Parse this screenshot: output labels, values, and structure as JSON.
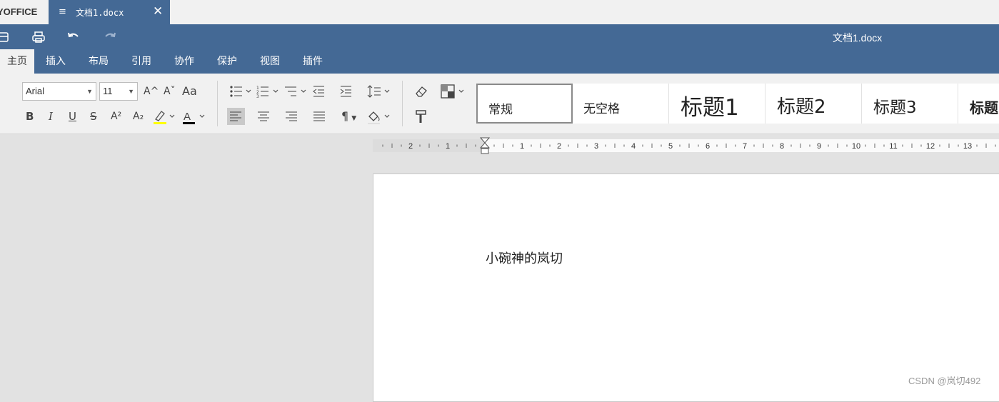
{
  "brand": "YOFFICE",
  "tab": {
    "menu_icon": "≡",
    "name": "文档1.docx",
    "close_icon": "✕"
  },
  "header": {
    "title": "文档1.docx"
  },
  "quick_access": [
    "save-icon",
    "print-icon",
    "undo-icon",
    "redo-icon"
  ],
  "menu": [
    "主页",
    "插入",
    "布局",
    "引用",
    "协作",
    "保护",
    "视图",
    "插件"
  ],
  "menu_active": "主页",
  "font": {
    "name": "Arial",
    "size": "11"
  },
  "format_buttons": {
    "bold": "B",
    "italic": "I",
    "underline": "U",
    "strike": "S",
    "superscript": "A²",
    "subscript": "A₂",
    "grow": "A^",
    "shrink": "Aˇ",
    "case": "Aa",
    "paragraph_mark": "¶"
  },
  "styles": [
    "常规",
    "无空格",
    "标题1",
    "标题2",
    "标题3",
    "标题"
  ],
  "styles_selected": "常规",
  "ruler": {
    "left_labels": [
      "2",
      "1"
    ],
    "right_labels": [
      "1",
      "2",
      "3",
      "4",
      "5",
      "6",
      "7",
      "8",
      "9",
      "10",
      "11",
      "12",
      "13"
    ]
  },
  "document": {
    "text": "小碗神的岚切"
  },
  "watermark": "CSDN @岚切492",
  "colors": {
    "accent": "#446995",
    "highlight": "#ffff00",
    "font_color": "#000000"
  }
}
